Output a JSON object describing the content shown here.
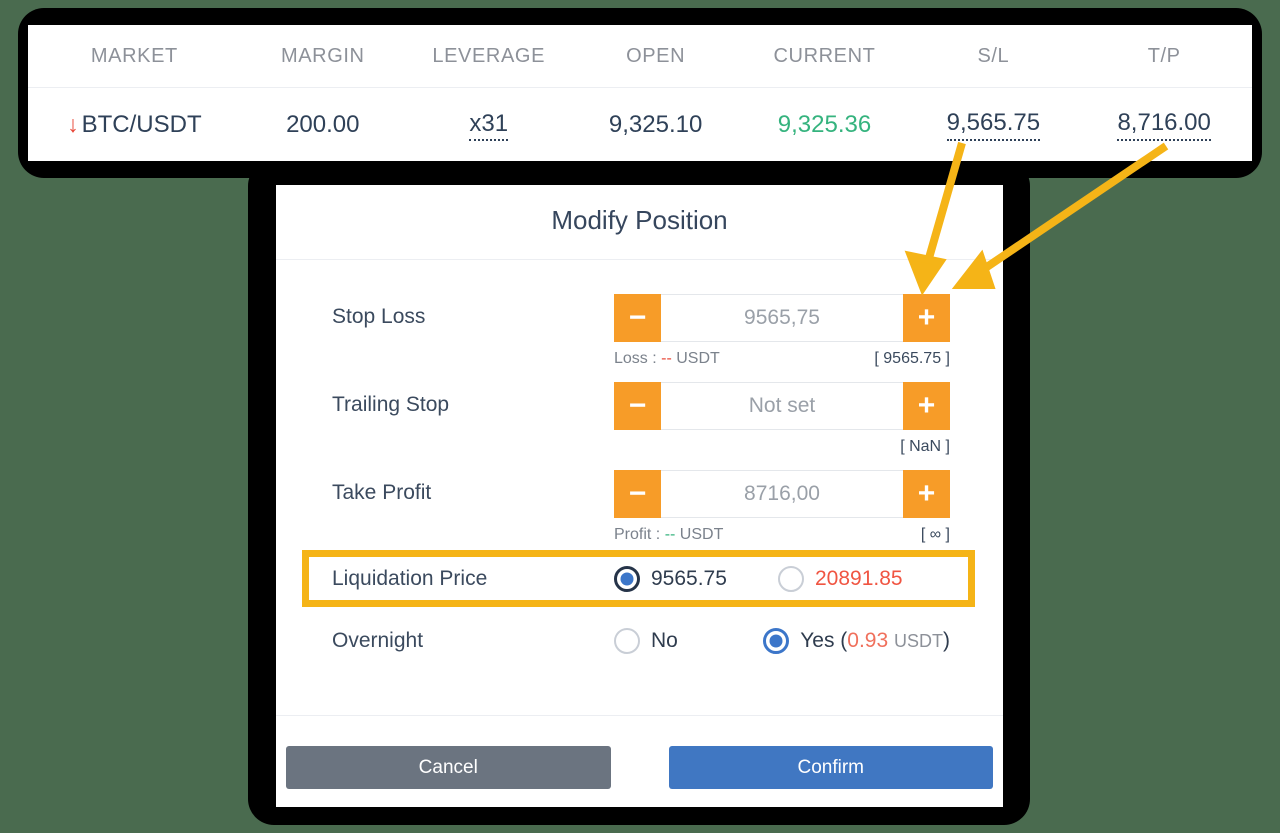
{
  "positions_table": {
    "columns": [
      "MARKET",
      "MARGIN",
      "LEVERAGE",
      "OPEN",
      "CURRENT",
      "S/L",
      "T/P"
    ],
    "row": {
      "direction_icon": "arrow-down-icon",
      "market": "BTC/USDT",
      "margin": "200.00",
      "leverage": "x31",
      "open": "9,325.10",
      "current": "9,325.36",
      "stop_loss": "9,565.75",
      "take_profit": "8,716.00"
    },
    "colors": {
      "header_text": "#8d9199",
      "cell_text": "#2f4158",
      "current_positive": "#35b37e",
      "direction_down": "#e8493a"
    }
  },
  "modal": {
    "title": "Modify Position",
    "stop_loss": {
      "label": "Stop Loss",
      "minus": "−",
      "plus": "+",
      "value": "9565,75",
      "hint_prefix": "Loss :",
      "hint_dash": "--",
      "hint_unit": "USDT",
      "hint_right": "[ 9565.75 ]"
    },
    "trailing_stop": {
      "label": "Trailing Stop",
      "minus": "−",
      "plus": "+",
      "value": "Not set",
      "hint_right": "[ NaN ]"
    },
    "take_profit": {
      "label": "Take Profit",
      "minus": "−",
      "plus": "+",
      "value": "8716,00",
      "hint_prefix": "Profit :",
      "hint_dash": "--",
      "hint_unit": "USDT",
      "hint_right": "[ ∞ ]"
    },
    "liquidation_price": {
      "label": "Liquidation Price",
      "option_selected": "9565.75",
      "option_other": "20891.85",
      "highlighted": true,
      "highlight_color": "#f5b417"
    },
    "overnight": {
      "label": "Overnight",
      "option_no": "No",
      "option_yes": "Yes (",
      "fee": "0.93",
      "unit": "USDT",
      "close_paren": ")"
    },
    "footer": {
      "cancel_label": "Cancel",
      "confirm_label": "Confirm",
      "cancel_color": "#6b7480",
      "confirm_color": "#4077c2"
    },
    "accent_orange": "#f79c28"
  },
  "annotations": {
    "arrow_color": "#f5b417",
    "arrows": [
      {
        "name": "arrow-sl-to-stop-loss-plus",
        "from": "S/L value",
        "to": "Stop Loss plus button"
      },
      {
        "name": "arrow-tp-to-stop-loss-plus",
        "from": "T/P value",
        "to": "Stop Loss plus button"
      }
    ]
  },
  "page": {
    "background": "#4a6b4f"
  }
}
